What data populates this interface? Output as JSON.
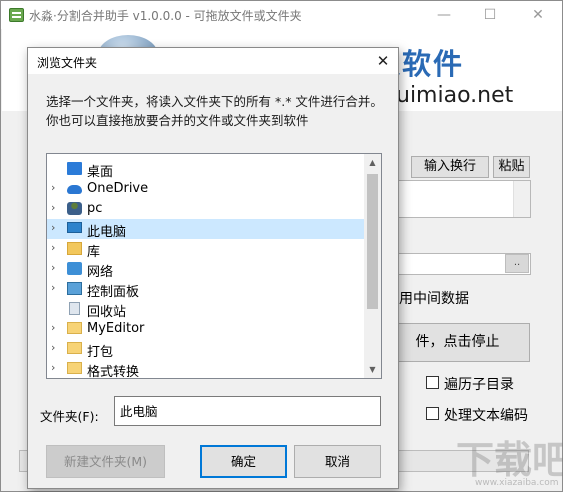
{
  "app": {
    "title": "水淼·分割合并助手 v1.0.0.0 - 可拖放文件或文件夹",
    "brand": "水淼软件",
    "brand_url": "uimiao.net",
    "input_newline_label": "输入换行",
    "paste_label": "粘贴",
    "browse_label": "..",
    "use_middle_data_label": "用中间数据",
    "stop_button_label": "件，点击停止",
    "history_subdir_label": "遍历子目录",
    "text_encoding_label": "处理文本编码",
    "watermark": "下载吧",
    "watermark_url": "www.xiazaiba.com"
  },
  "dialog": {
    "title": "浏览文件夹",
    "close_glyph": "✕",
    "description": "选择一个文件夹，将读入文件夹下的所有 *.* 文件进行合并。你也可以直接拖放要合并的文件或文件夹到软件",
    "tree": [
      {
        "label": "桌面",
        "icon": "desktop-icon",
        "expandable": false
      },
      {
        "label": "OneDrive",
        "icon": "onedrive-icon",
        "expandable": true
      },
      {
        "label": "pc",
        "icon": "user-folder-icon",
        "expandable": true
      },
      {
        "label": "此电脑",
        "icon": "this-pc-icon",
        "expandable": true,
        "selected": true
      },
      {
        "label": "库",
        "icon": "libraries-icon",
        "expandable": true
      },
      {
        "label": "网络",
        "icon": "network-icon",
        "expandable": true
      },
      {
        "label": "控制面板",
        "icon": "control-panel-icon",
        "expandable": true
      },
      {
        "label": "回收站",
        "icon": "recycle-bin-icon",
        "expandable": false
      },
      {
        "label": "MyEditor",
        "icon": "folder-icon",
        "expandable": true
      },
      {
        "label": "打包",
        "icon": "folder-icon",
        "expandable": true
      },
      {
        "label": "格式转换",
        "icon": "folder-icon",
        "expandable": true
      }
    ],
    "folder_label": "文件夹(F):",
    "folder_value": "此电脑",
    "new_folder_label": "新建文件夹(M)",
    "ok_label": "确定",
    "cancel_label": "取消"
  }
}
